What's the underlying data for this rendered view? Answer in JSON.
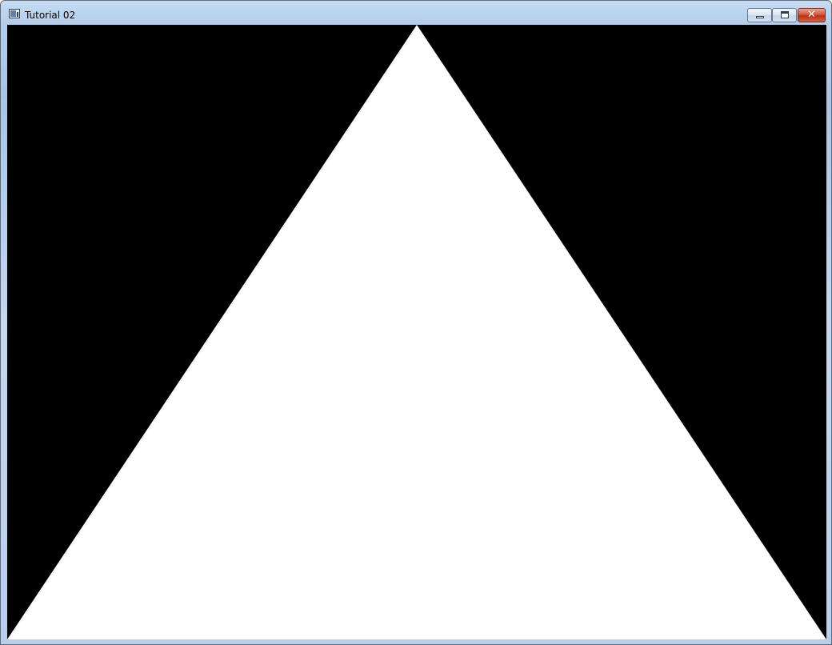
{
  "window": {
    "title": "Tutorial 02",
    "icon": "application-window-icon"
  },
  "caption_buttons": {
    "minimize_icon": "minimize-icon",
    "maximize_icon": "maximize-icon",
    "close_glyph": "✕"
  },
  "scene": {
    "background_color": "#000000",
    "shape": "triangle",
    "shape_color": "#ffffff"
  }
}
